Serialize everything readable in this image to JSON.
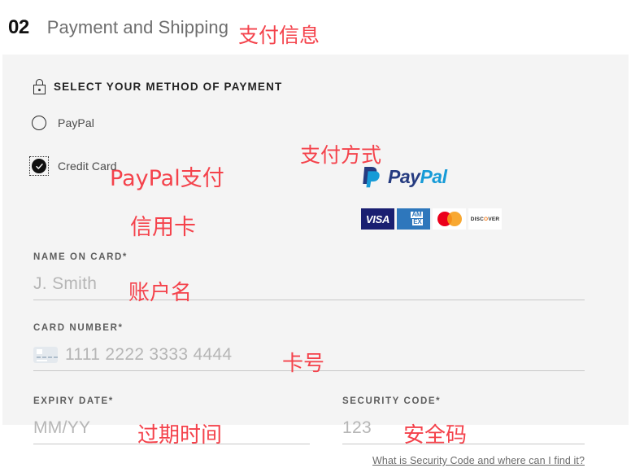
{
  "header": {
    "step_number": "02",
    "step_title": "Payment and Shipping",
    "annotation": "支付信息"
  },
  "payment_section": {
    "heading": "SELECT YOUR METHOD OF PAYMENT",
    "heading_annotation": "支付方式",
    "lock_icon": "lock-icon",
    "options": [
      {
        "label": "PayPal",
        "annotation": "PayPal支付",
        "selected": false
      },
      {
        "label": "Credit Card",
        "annotation": "信用卡",
        "selected": true
      }
    ],
    "paypal_logo": {
      "word_first": "Pay",
      "word_second": "Pal",
      "color_dark": "#253b80",
      "color_light": "#179bd7"
    },
    "card_brands": [
      {
        "name": "VISA",
        "text": "VISA",
        "bg": "#1a1f71",
        "fg": "#ffffff"
      },
      {
        "name": "AMEX",
        "text_top": "AM",
        "text_bottom": "EX",
        "bg": "#2e77bc",
        "fg": "#ffffff"
      },
      {
        "name": "Mastercard",
        "bg": "#ffffff",
        "circle_left": "#eb001b",
        "circle_right": "#f79e1b"
      },
      {
        "name": "Discover",
        "text_a": "DISC",
        "text_o": "O",
        "text_b": "VER",
        "bg": "#ffffff",
        "fg": "#2b2b2b",
        "accent": "#f48024"
      }
    ]
  },
  "form": {
    "name_on_card": {
      "label": "NAME ON CARD*",
      "placeholder": "J. Smith",
      "value": "",
      "annotation": "账户名"
    },
    "card_number": {
      "label": "CARD NUMBER*",
      "placeholder": "1111 2222 3333 4444",
      "value": "",
      "annotation": "卡号",
      "icon": "credit-card-icon"
    },
    "expiry_date": {
      "label": "EXPIRY DATE*",
      "placeholder": "MM/YY",
      "value": "",
      "annotation": "过期时间"
    },
    "security_code": {
      "label": "SECURITY CODE*",
      "placeholder": "123",
      "value": "",
      "annotation": "安全码"
    },
    "help_link": "What is Security Code and where can I find it?"
  },
  "colors": {
    "page_bg": "#f4f4f4",
    "header_bg": "#ffffff",
    "annotation_red": "#f4424b",
    "field_underline": "#c8c8c8",
    "placeholder_gray": "#b6b6b6"
  }
}
